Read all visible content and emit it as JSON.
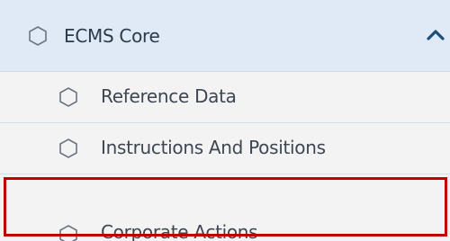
{
  "menu": {
    "header": {
      "label": "ECMS Core",
      "icon": "hexagon-icon",
      "toggle_icon": "chevron-up-icon",
      "expanded": true
    },
    "items": [
      {
        "label": "Reference Data",
        "icon": "hexagon-icon"
      },
      {
        "label": "Instructions And Positions",
        "icon": "hexagon-icon"
      },
      {
        "label": "Corporate Actions",
        "icon": "hexagon-icon",
        "highlighted": true
      }
    ]
  },
  "colors": {
    "header_background": "#dfeaf6",
    "item_background": "#f3f3f3",
    "highlight_border": "#c00000",
    "chevron": "#1f4e79",
    "icon_stroke": "#6b7480"
  }
}
